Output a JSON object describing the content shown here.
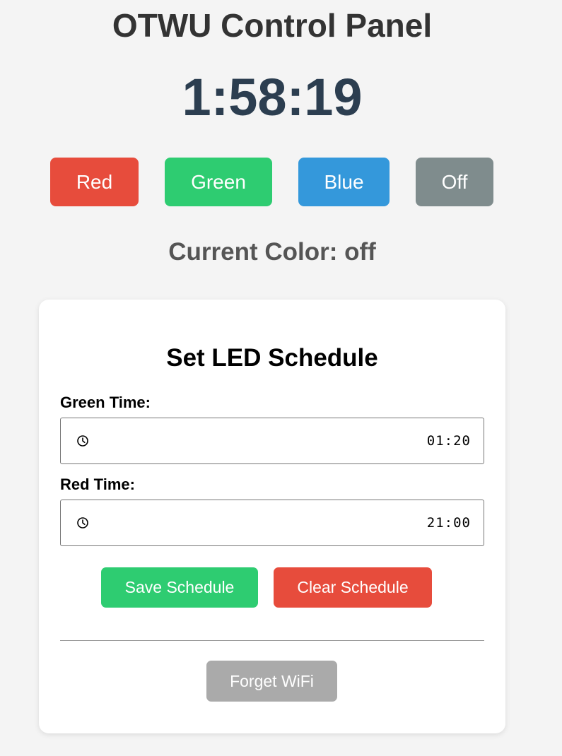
{
  "header": {
    "title": "OTWU Control Panel",
    "clock": "1:58:19"
  },
  "color_buttons": [
    {
      "label": "Red",
      "color": "#e74c3c"
    },
    {
      "label": "Green",
      "color": "#2ecc71"
    },
    {
      "label": "Blue",
      "color": "#3498db"
    },
    {
      "label": "Off",
      "color": "#7f8c8d"
    }
  ],
  "status": {
    "current_color_text": "Current Color: off"
  },
  "schedule": {
    "title": "Set LED Schedule",
    "green_time": {
      "label": "Green Time:",
      "value": "01:20",
      "icon": "clock-icon"
    },
    "red_time": {
      "label": "Red Time:",
      "value": "21:00",
      "icon": "clock-icon"
    },
    "save_button": {
      "label": "Save Schedule",
      "color": "#2ecc71"
    },
    "clear_button": {
      "label": "Clear Schedule",
      "color": "#e74c3c"
    },
    "forget_button": {
      "label": "Forget WiFi",
      "color": "#aaaaaa"
    }
  }
}
